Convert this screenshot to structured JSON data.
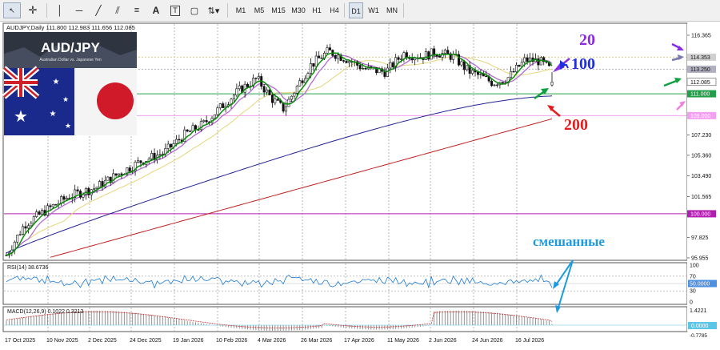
{
  "toolbar": {
    "timeframes": [
      "M1",
      "M5",
      "M15",
      "M30",
      "H1",
      "H4",
      "D1",
      "W1",
      "MN"
    ],
    "active_timeframe": "D1"
  },
  "chart": {
    "header": "AUDJPY,Daily  111.800 112.983 111.656 112.085",
    "logo_title": "AUD/JPY",
    "logo_subtitle": "Australian Dollar vs. Japanese Yen",
    "rsi_label": "RSI(14) 38.6736",
    "macd_label": "MACD(12,26,9) 0.1022 0.3213",
    "annotations": {
      "ma20": "20",
      "ma100": "100",
      "ma200": "200",
      "mixed": "смешанные"
    },
    "colors": {
      "ma20": "#0a8a0a",
      "ma_purple": "#b06ad0",
      "ma_yellow": "#e4d67a",
      "ma100": "#232396",
      "ma200": "#c02020",
      "arrow_purple": "#8a2be2",
      "arrow_blue": "#1f2fe0",
      "arrow_green": "#10a040",
      "arrow_pink": "#f080e0",
      "arrow_gray": "#7a7ab0",
      "arrow_red": "#e02020",
      "text_cyan": "#1d9be0"
    }
  },
  "chart_data": {
    "type": "candlestick",
    "symbol": "AUDJPY",
    "timeframe": "Daily",
    "ohlc_last": {
      "open": 111.8,
      "high": 112.983,
      "low": 111.656,
      "close": 112.085
    },
    "y_ticks": [
      "116.365",
      "113.250",
      "112.085",
      "111.000",
      "109.000",
      "107.230",
      "105.360",
      "103.490",
      "101.565",
      "100.000",
      "97.825",
      "95.955"
    ],
    "x_ticks": [
      "17 Oct 2025",
      "10 Nov 2025",
      "2 Dec 2025",
      "24 Dec 2025",
      "19 Jan 2026",
      "10 Feb 2026",
      "4 Mar 2026",
      "26 Mar 2026",
      "17 Apr 2026",
      "11 May 2026",
      "2 Jun 2026",
      "24 Jun 2026",
      "16 Jul 2026"
    ],
    "price_markers": [
      {
        "label": "114.353",
        "value": 114.353,
        "color": "#d0d0d0"
      },
      {
        "label": "113.250",
        "value": 113.25,
        "color": "#b0b0c0"
      },
      {
        "label": "112.085",
        "value": 112.085,
        "color": "#ffffff"
      },
      {
        "label": "111.000",
        "value": 111.0,
        "color": "#22a049"
      },
      {
        "label": "109.000",
        "value": 109.0,
        "color": "#f3a0f0"
      },
      {
        "label": "100.000",
        "value": 100.0,
        "color": "#b020b0"
      }
    ],
    "rsi": {
      "value": 38.6736,
      "levels": [
        "100",
        "70",
        "50",
        "30",
        "0"
      ],
      "marker": "50.0000"
    },
    "macd": {
      "main": 0.1022,
      "signal": 0.3213,
      "top_label": "1.4221",
      "zero_label": "0.0000",
      "bottom_label": "-0.7785"
    }
  }
}
